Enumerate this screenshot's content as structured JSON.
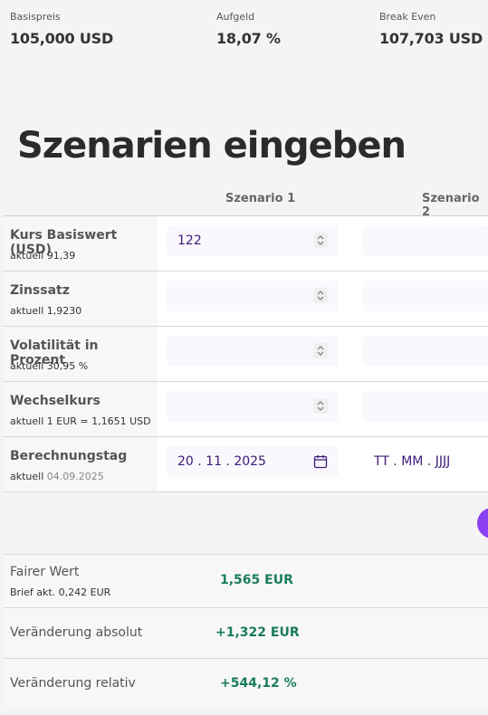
{
  "summary": [
    {
      "label": "Basispreis",
      "value": "105,000 USD"
    },
    {
      "label": "Aufgeld",
      "value": "18,07 %"
    },
    {
      "label": "Break Even",
      "value": "107,703 USD"
    }
  ],
  "section_title": "Szenarien eingeben",
  "columns": {
    "scenario1": "Szenario 1",
    "scenario2": "Szenario 2"
  },
  "inputs": [
    {
      "label": "Kurs Basiswert (USD)",
      "sub_prefix": "aktuell",
      "sub_value": "91,39",
      "scenario1_value": "122",
      "scenario2_value": ""
    },
    {
      "label": "Zinssatz",
      "sub_prefix": "aktuell",
      "sub_value": "1,9230",
      "scenario1_value": "",
      "scenario2_value": ""
    },
    {
      "label": "Volatilität in Prozent",
      "sub_prefix": "aktuell",
      "sub_value": "30,95 %",
      "scenario1_value": "",
      "scenario2_value": ""
    },
    {
      "label": "Wechselkurs",
      "sub_prefix": "aktuell",
      "sub_value": "1 EUR = 1,1651 USD",
      "scenario1_value": "",
      "scenario2_value": ""
    },
    {
      "label": "Berechnungstag",
      "sub_prefix": "aktuell",
      "sub_value": "04.09.2025",
      "scenario1_value": "20 . 11 . 2025",
      "scenario2_value": "TT . MM . JJJJ"
    }
  ],
  "results": [
    {
      "label": "Fairer Wert",
      "sub": "Brief akt. 0,242 EUR",
      "value": "1,565 EUR"
    },
    {
      "label": "Veränderung absolut",
      "value": "+1,322 EUR"
    },
    {
      "label": "Veränderung relativ",
      "value": "+544,12 %"
    }
  ],
  "icons": {
    "spinner": "spinner-arrows-icon",
    "calendar": "calendar-icon"
  },
  "colors": {
    "accent": "#8a3ff0",
    "input_text": "#3d1a78",
    "positive": "#1a7d57"
  }
}
